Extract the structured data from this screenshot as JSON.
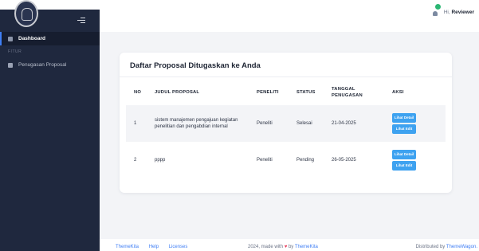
{
  "sidebar": {
    "nav": [
      {
        "label": "Dashboard"
      },
      {
        "label": "Penugasan Proposal"
      }
    ],
    "section_label": "FITUR"
  },
  "header": {
    "greeting_prefix": "Hi,",
    "user_name": "Reviewer"
  },
  "card": {
    "title": "Daftar Proposal Ditugaskan ke Anda",
    "columns": [
      "NO",
      "JUDUL PROPOSAL",
      "PENELITI",
      "STATUS",
      "TANGGAL PENUGASAN",
      "AKSI"
    ],
    "rows": [
      {
        "no": "1",
        "judul": "sistem manajemen pengajuan kegiatan penelitian dan pengabdian internal",
        "peneliti": "Peneliti",
        "status": "Selesai",
        "tanggal": "21-04-2025",
        "btn_detail": "Lihat Detail",
        "btn_edit": "Lihat Edit"
      },
      {
        "no": "2",
        "judul": "pppp",
        "peneliti": "Peneliti",
        "status": "Pending",
        "tanggal": "26-05-2025",
        "btn_detail": "Lihat Detail",
        "btn_edit": "Lihat Edit"
      }
    ]
  },
  "footer": {
    "links": [
      "ThemeKita",
      "Help",
      "Licenses"
    ],
    "made_with_prefix": "2024, made with",
    "made_with_by": "by",
    "made_with_brand": "ThemeKita",
    "distributed_prefix": "Distributed by",
    "distributed_brand": "ThemeWagon."
  },
  "colors": {
    "sidebar_bg": "#1f283e",
    "accent": "#3f7ef5",
    "button": "#3ea2f0",
    "notification_dot": "#2bb673",
    "heart": "#e83e5c"
  },
  "icons": [
    "logo-emblem",
    "hamburger-icon",
    "dashboard-icon",
    "document-icon",
    "bell-icon",
    "heart-icon"
  ]
}
